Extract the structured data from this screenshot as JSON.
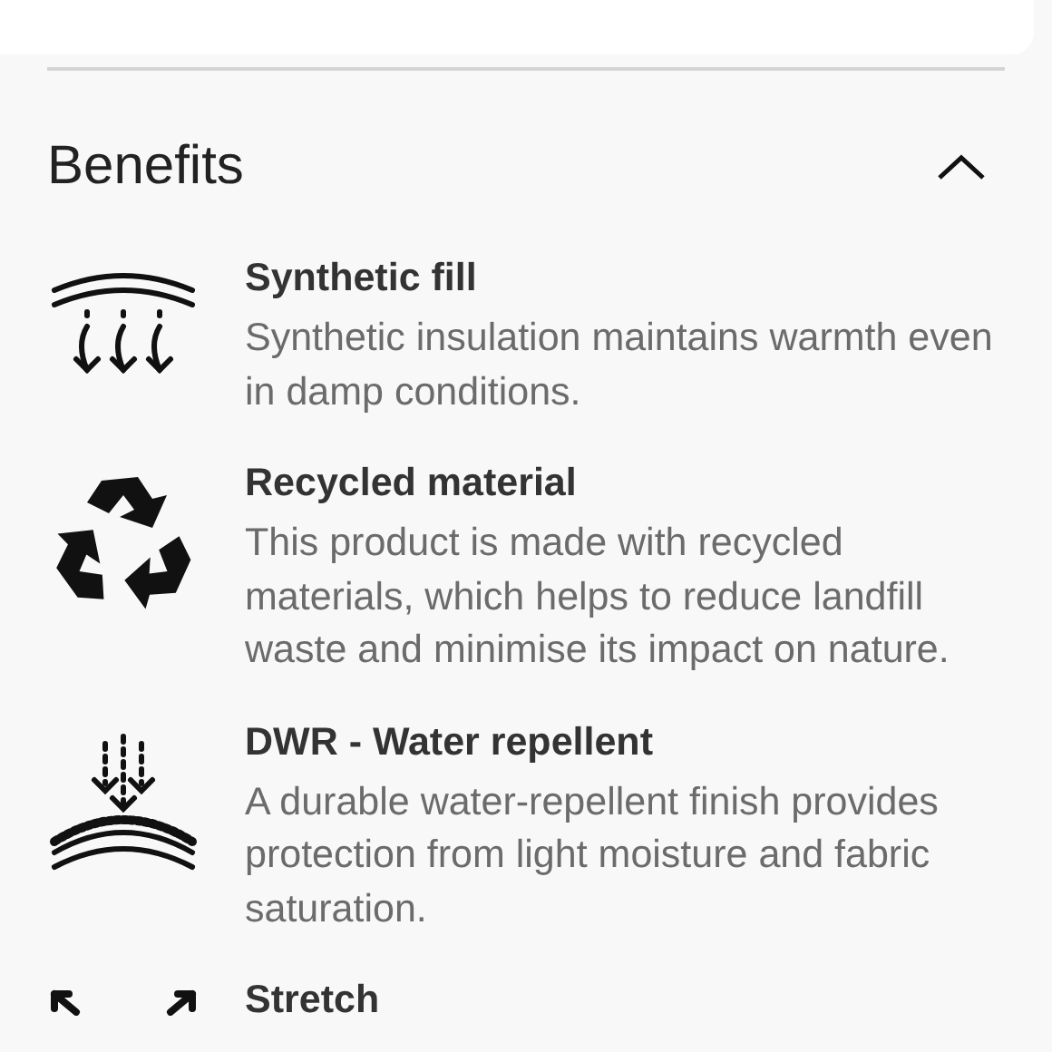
{
  "section": {
    "title": "Benefits",
    "expanded": true
  },
  "benefits": [
    {
      "kind": "fill",
      "title": "Synthetic fill",
      "description": "Synthetic insulation maintains warmth even in damp conditions."
    },
    {
      "kind": "recycled",
      "title": "Recycled material",
      "description": "This product is made with recycled materials, which helps to reduce landfill waste and minimise its impact on nature."
    },
    {
      "kind": "water",
      "title": "DWR - Water repellent",
      "description": "A durable water-repellent finish provides protection from light moisture and fabric saturation."
    },
    {
      "kind": "stretch",
      "title": "Stretch"
    }
  ]
}
